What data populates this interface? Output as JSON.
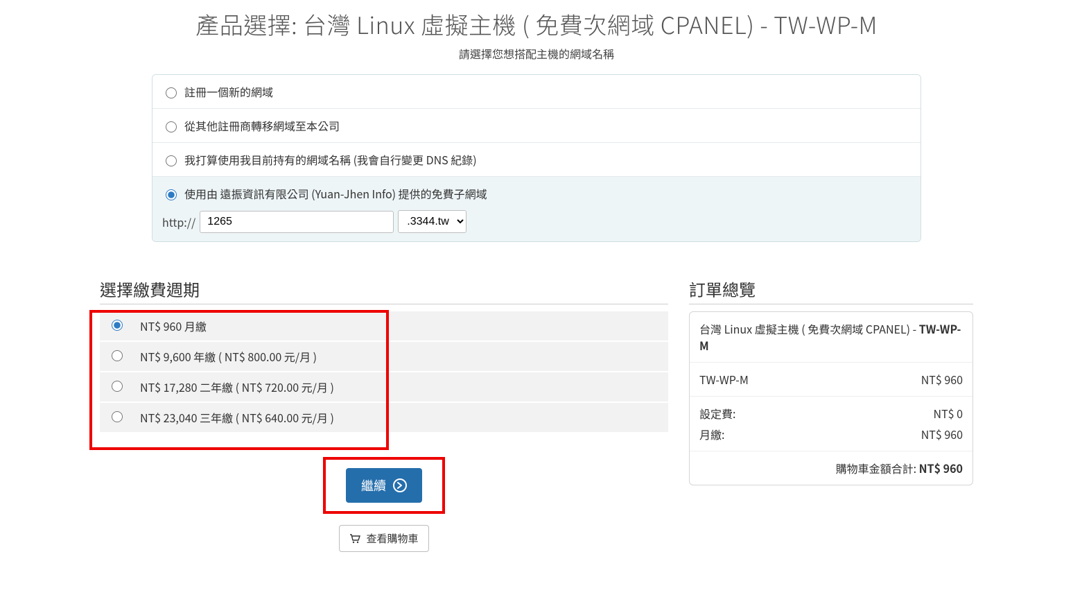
{
  "title": "產品選擇: 台灣 Linux 虛擬主機 ( 免費次網域 CPANEL) - TW-WP-M",
  "subtitle": "請選擇您想搭配主機的網域名稱",
  "domain_options": [
    {
      "label": "註冊一個新的網域",
      "checked": false
    },
    {
      "label": "從其他註冊商轉移網域至本公司",
      "checked": false
    },
    {
      "label": "我打算使用我目前持有的網域名稱 (我會自行變更 DNS 紀錄)",
      "checked": false
    },
    {
      "label": "使用由 遠振資訊有限公司 (Yuan-Jhen Info) 提供的免費子網域",
      "checked": true
    }
  ],
  "subdomain": {
    "proto": "http://",
    "value": "1265",
    "tld": ".3344.tw"
  },
  "section_cycle": "選擇繳費週期",
  "cycle_options": [
    {
      "label": "NT$ 960 月繳",
      "checked": true
    },
    {
      "label": "NT$ 9,600 年繳 ( NT$ 800.00 元/月 )",
      "checked": false
    },
    {
      "label": "NT$ 17,280 二年繳 ( NT$ 720.00 元/月 )",
      "checked": false
    },
    {
      "label": "NT$ 23,040 三年繳 ( NT$ 640.00 元/月 )",
      "checked": false
    }
  ],
  "section_summary": "訂單總覽",
  "summary": {
    "product_line_prefix": "台灣 Linux 虛擬主機 ( 免費次網域 CPANEL) - ",
    "product_line_bold": "TW-WP-M",
    "item_name": "TW-WP-M",
    "item_price": "NT$ 960",
    "setup_label": "設定費:",
    "setup_value": "NT$ 0",
    "period_label": "月繳:",
    "period_value": "NT$ 960",
    "total_label": "購物車金額合計: ",
    "total_value": "NT$ 960"
  },
  "buttons": {
    "continue": "繼續",
    "view_cart": "查看購物車"
  }
}
